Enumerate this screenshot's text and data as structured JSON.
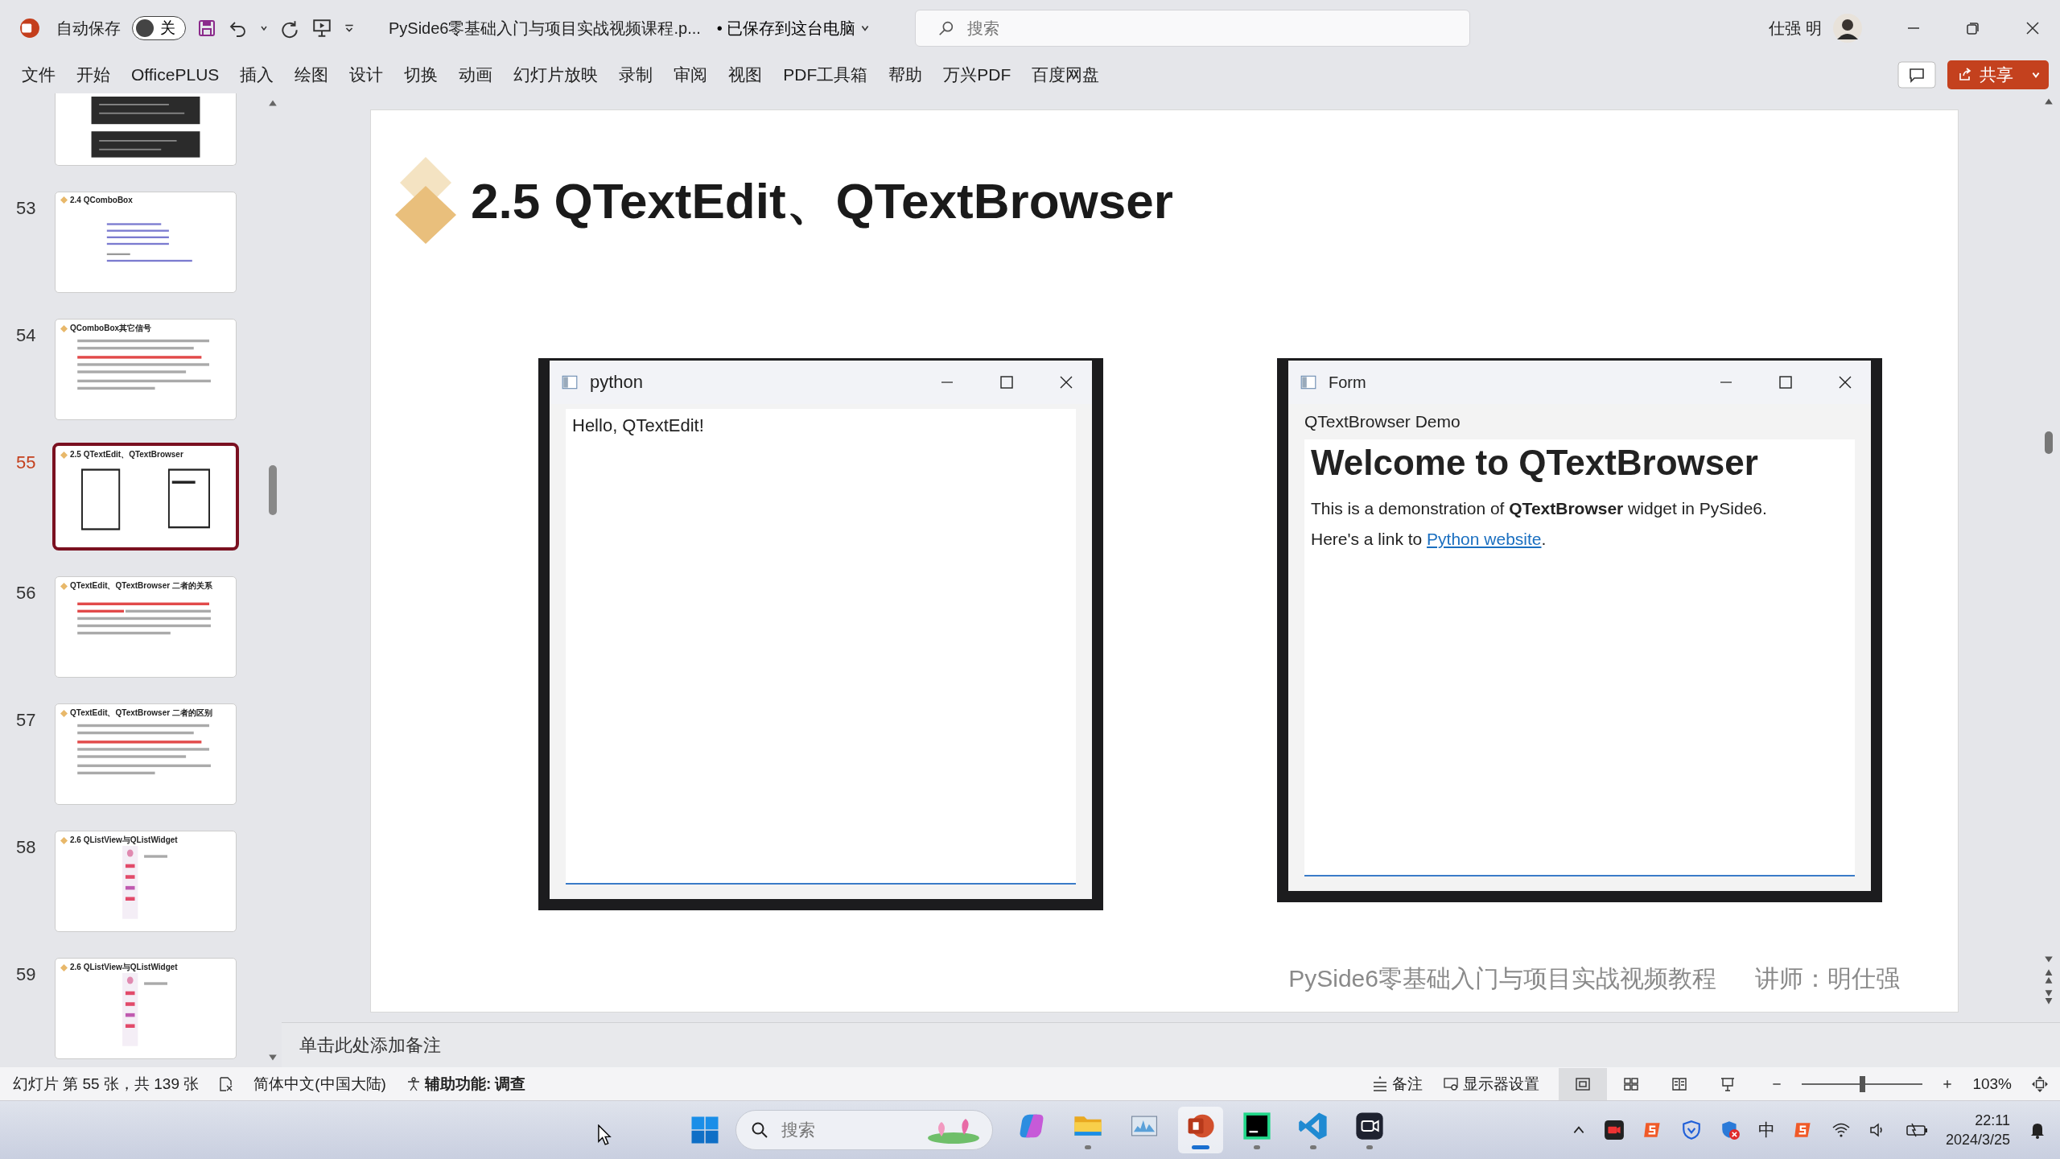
{
  "app": {
    "autosave_label": "自动保存",
    "autosave_on": false,
    "autosave_state": "关",
    "doc_title": "PySide6零基础入门与项目实战视频课程.p...",
    "save_status": "• 已保存到这台电脑",
    "search_placeholder": "搜索",
    "user": "仕强 明"
  },
  "ribbon_tabs": [
    "文件",
    "开始",
    "OfficePLUS",
    "插入",
    "绘图",
    "设计",
    "切换",
    "动画",
    "幻灯片放映",
    "录制",
    "审阅",
    "视图",
    "PDF工具箱",
    "帮助",
    "万兴PDF",
    "百度网盘"
  ],
  "share": "共享",
  "thumbnails": [
    {
      "kind": "code",
      "selected": false
    },
    {
      "kind": "code_text",
      "number": "53",
      "title": "2.4 QComboBox",
      "selected": false
    },
    {
      "kind": "text",
      "number": "54",
      "title": "QComboBox其它信号",
      "selected": false
    },
    {
      "kind": "windows",
      "number": "55",
      "title": "2.5  QTextEdit、QTextBrowser",
      "selected": true
    },
    {
      "kind": "red_text",
      "number": "56",
      "title": "QTextEdit、QTextBrowser 二者的关系",
      "selected": false
    },
    {
      "kind": "text",
      "number": "57",
      "title": "QTextEdit、QTextBrowser 二者的区别",
      "selected": false
    },
    {
      "kind": "list",
      "number": "58",
      "title": "2.6  QListView与QListWidget",
      "selected": false
    },
    {
      "kind": "list",
      "number": "59",
      "title": "2.6  QListView与QListWidget",
      "selected": false
    }
  ],
  "slide": {
    "title": "2.5  QTextEdit、QTextBrowser",
    "windows": [
      {
        "kind": "editor",
        "title": "python",
        "text": "Hello, QTextEdit!"
      },
      {
        "kind": "browser",
        "title": "Form",
        "label": "QTextBrowser Demo",
        "heading": "Welcome to QTextBrowser",
        "paragraph": "This is a demonstration of **QTextBrowser** widget in PySide6.",
        "link_prefix": "Here's a link to",
        "link": "Python website",
        "link_suffix": "."
      }
    ],
    "footer": "PySide6零基础入门与项目实战视频教程",
    "lecturer": "讲师：明仕强"
  },
  "notes_placeholder": "单击此处添加备注",
  "status_bar": {
    "slide_count": "幻灯片 第 55 张，共 139 张",
    "language": "简体中文(中国大陆)",
    "accessibility": "辅助功能: 调查",
    "notes": "备注",
    "display_settings": "显示器设置",
    "views": [
      {
        "kind": "normal",
        "selected": true
      },
      {
        "kind": "sorter",
        "selected": false
      },
      {
        "kind": "reading",
        "selected": false
      },
      {
        "kind": "show",
        "selected": false
      }
    ],
    "zoom": {
      "level": 0.5,
      "reading": "103%"
    }
  },
  "taskbar": {
    "search_placeholder": "搜索",
    "apps": [
      {
        "kind": "copilot",
        "running": false,
        "selected": false
      },
      {
        "kind": "folder",
        "running": true,
        "selected": false
      },
      {
        "kind": "monitor",
        "running": false,
        "selected": false
      },
      {
        "kind": "powerpoint",
        "running": true,
        "selected": true
      },
      {
        "kind": "pycharm",
        "running": true,
        "selected": false
      },
      {
        "kind": "vscode",
        "running": true,
        "selected": false
      },
      {
        "kind": "camera",
        "running": true,
        "selected": false
      }
    ],
    "ime": "中",
    "time": "22:11",
    "date": "2024/3/25"
  }
}
